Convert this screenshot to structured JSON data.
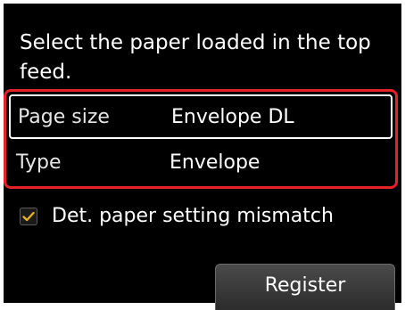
{
  "prompt": "Select the paper loaded in the top feed.",
  "settings": [
    {
      "label": "Page size",
      "value": "Envelope DL"
    },
    {
      "label": "Type",
      "value": "Envelope"
    }
  ],
  "mismatch": {
    "label": "Det. paper setting mismatch",
    "checked": true
  },
  "register_label": "Register",
  "colors": {
    "background": "#000000",
    "highlight": "#e8202a",
    "check": "#e3b21a",
    "text": "#ffffff"
  }
}
